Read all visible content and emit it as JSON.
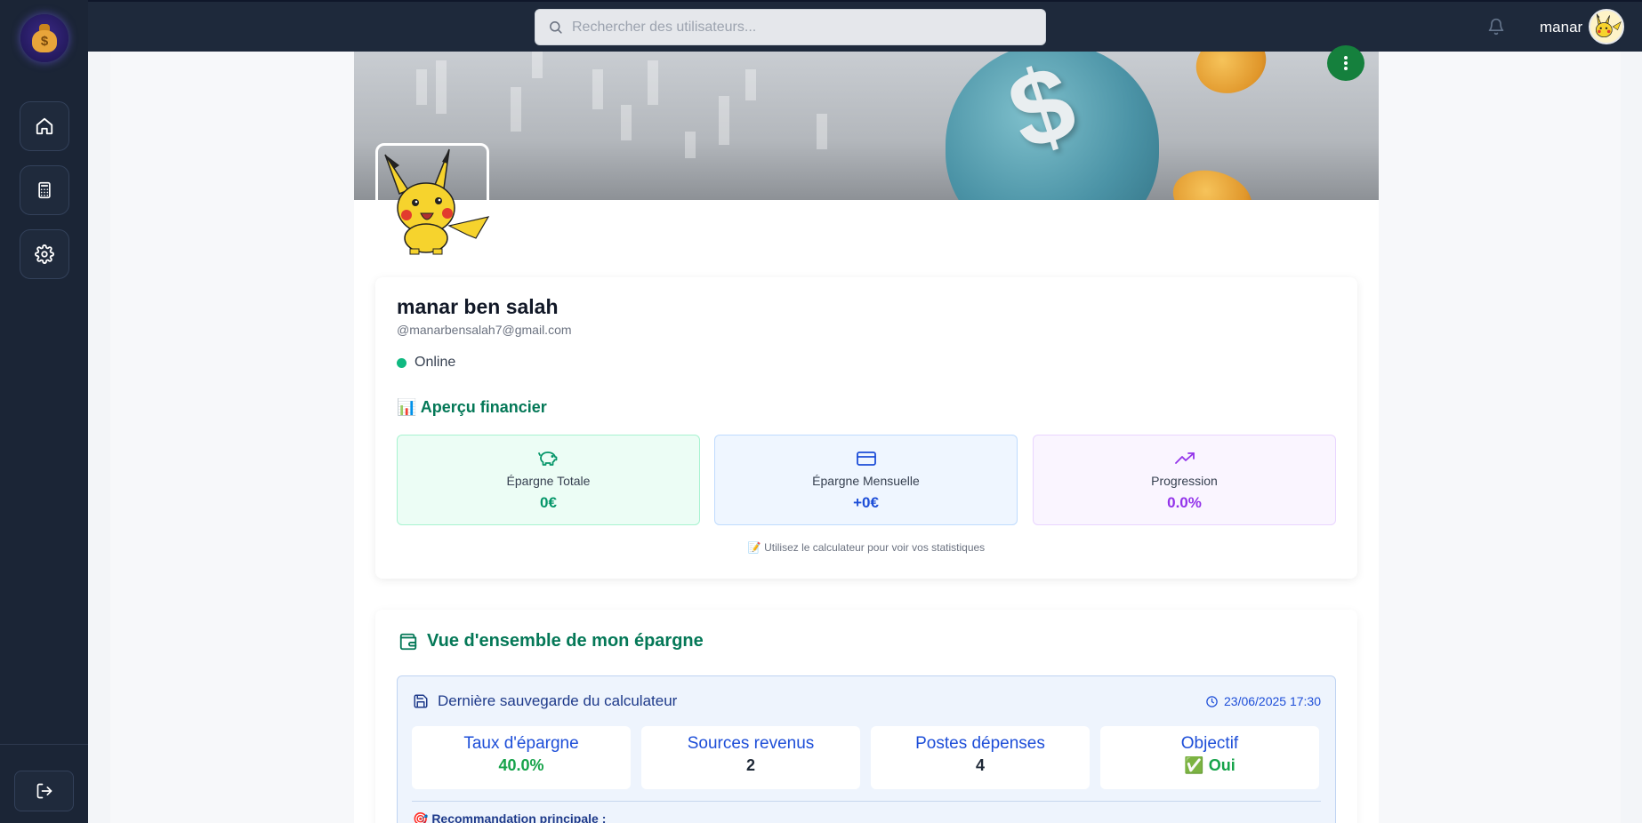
{
  "app": {
    "logo": "money-bag-icon",
    "logo_symbol": "$"
  },
  "sidebar": {
    "items": [
      {
        "name": "home",
        "icon": "home-icon"
      },
      {
        "name": "calculator",
        "icon": "calculator-icon"
      },
      {
        "name": "settings",
        "icon": "gear-icon"
      }
    ],
    "logout_icon": "logout-icon"
  },
  "topbar": {
    "search_placeholder": "Rechercher des utilisateurs...",
    "username": "manar",
    "bell_icon": "bell-icon"
  },
  "profile": {
    "name": "manar ben salah",
    "email": "@manarbensalah7@gmail.com",
    "status": "Online",
    "status_color": "#10b981"
  },
  "financial": {
    "title": "📊 Aperçu financier",
    "cards": [
      {
        "icon": "piggy-bank-icon",
        "label": "Épargne Totale",
        "value": "0€",
        "color": "#059669",
        "bg": "#ecfdf5",
        "border": "#a7f3d0"
      },
      {
        "icon": "credit-card-icon",
        "label": "Épargne Mensuelle",
        "value": "+0€",
        "color": "#1d4ed8",
        "bg": "#eff6ff",
        "border": "#bfdbfe"
      },
      {
        "icon": "trending-up-icon",
        "label": "Progression",
        "value": "0.0%",
        "color": "#9333ea",
        "bg": "#faf5ff",
        "border": "#e9d5ff"
      }
    ],
    "note": "📝 Utilisez le calculateur pour voir vos statistiques"
  },
  "overview": {
    "title": "Vue d'ensemble de mon épargne",
    "calc": {
      "title": "Dernière sauvegarde du calculateur",
      "date": "23/06/2025 17:30",
      "stats": [
        {
          "label": "Taux d'épargne",
          "value": "40.0%",
          "color": "#16a34a"
        },
        {
          "label": "Sources revenus",
          "value": "2",
          "color": "#1f2937"
        },
        {
          "label": "Postes dépenses",
          "value": "4",
          "color": "#1f2937"
        },
        {
          "label": "Objectif",
          "value": "✅ Oui",
          "color": "#16a34a"
        }
      ],
      "recommendation_label": "🎯 Recommandation principale :"
    }
  },
  "colors": {
    "sidebar": "#1b2536",
    "topbar": "#1e293b",
    "accent_green": "#047857",
    "fab": "#15803d"
  }
}
